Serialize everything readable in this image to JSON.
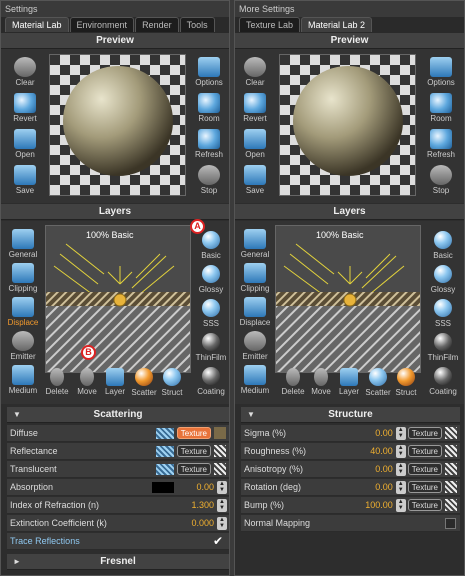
{
  "left": {
    "title": "Settings",
    "tabs": [
      "Material Lab",
      "Environment",
      "Render",
      "Tools"
    ],
    "preview_title": "Preview",
    "left_tools": [
      "Clear",
      "Revert",
      "Open",
      "Save"
    ],
    "right_tools": [
      "Options",
      "Room",
      "Refresh",
      "Stop"
    ],
    "layers_title": "Layers",
    "layer_side": [
      "General",
      "Clipping",
      "Displace",
      "Emitter",
      "Medium"
    ],
    "layer_right": [
      "Basic",
      "Glossy",
      "SSS",
      "ThinFilm",
      "Coating"
    ],
    "layer_bottom": [
      "Delete",
      "Move",
      "Layer",
      "Scatter",
      "Struct"
    ],
    "layer_label": "100% Basic",
    "annot_a": "A",
    "annot_b": "B",
    "scattering_title": "Scattering",
    "rows": [
      {
        "name": "Diffuse",
        "tex": "Texture"
      },
      {
        "name": "Reflectance",
        "tex": "Texture"
      },
      {
        "name": "Translucent",
        "tex": "Texture"
      },
      {
        "name": "Absorption",
        "val": "0.00"
      },
      {
        "name": "Index of Refraction (n)",
        "val": "1.300"
      },
      {
        "name": "Extinction Coefficient (k)",
        "val": "0.000"
      },
      {
        "name": "Trace Reflections"
      }
    ],
    "fresnel_title": "Fresnel"
  },
  "right": {
    "title": "More Settings",
    "tabs": [
      "Texture Lab",
      "Material Lab 2"
    ],
    "preview_title": "Preview",
    "left_tools": [
      "Clear",
      "Revert",
      "Open",
      "Save"
    ],
    "right_tools": [
      "Options",
      "Room",
      "Refresh",
      "Stop"
    ],
    "layers_title": "Layers",
    "layer_side": [
      "General",
      "Clipping",
      "Displace",
      "Emitter",
      "Medium"
    ],
    "layer_right": [
      "Basic",
      "Glossy",
      "SSS",
      "ThinFilm",
      "Coating"
    ],
    "layer_bottom": [
      "Delete",
      "Move",
      "Layer",
      "Scatter",
      "Struct"
    ],
    "layer_label": "100% Basic",
    "structure_title": "Structure",
    "rows": [
      {
        "name": "Sigma (%)",
        "val": "0.00",
        "tex": "Texture"
      },
      {
        "name": "Roughness (%)",
        "val": "40.00",
        "tex": "Texture"
      },
      {
        "name": "Anisotropy (%)",
        "val": "0.00",
        "tex": "Texture"
      },
      {
        "name": "Rotation (deg)",
        "val": "0.00",
        "tex": "Texture"
      },
      {
        "name": "Bump (%)",
        "val": "100.00",
        "tex": "Texture"
      },
      {
        "name": "Normal Mapping"
      }
    ]
  }
}
